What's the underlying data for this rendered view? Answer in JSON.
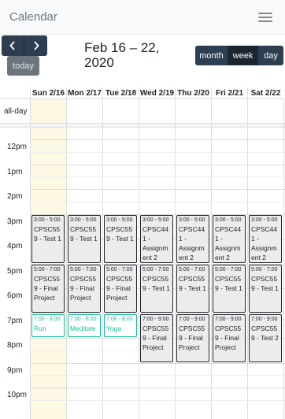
{
  "app": {
    "title": "Calendar"
  },
  "toolbar": {
    "prev_label": "‹",
    "next_label": "›",
    "today_label": "today",
    "range_title": "Feb 16 – 22, 2020",
    "views": {
      "month": "month",
      "week": "week",
      "day": "day"
    },
    "active_view": "week"
  },
  "calendar": {
    "days": [
      "Sun 2/16",
      "Mon 2/17",
      "Tue 2/18",
      "Wed 2/19",
      "Thu 2/20",
      "Fri 2/21",
      "Sat 2/22"
    ],
    "today_index": 0,
    "allday_label": "all-day",
    "hours": [
      "12pm",
      "1pm",
      "2pm",
      "3pm",
      "4pm",
      "5pm",
      "6pm",
      "7pm",
      "8pm",
      "9pm",
      "10pm"
    ],
    "events": [
      {
        "day": 0,
        "start": 15,
        "end": 17,
        "time": "3:00 - 5:00",
        "title": "CPSC559 - Test 1",
        "style": "gray"
      },
      {
        "day": 1,
        "start": 15,
        "end": 17,
        "time": "3:00 - 5:00",
        "title": "CPSC559 - Test 1",
        "style": "gray"
      },
      {
        "day": 2,
        "start": 15,
        "end": 17,
        "time": "3:00 - 5:00",
        "title": "CPSC559 - Test 1",
        "style": "gray"
      },
      {
        "day": 3,
        "start": 15,
        "end": 17,
        "time": "3:00 - 5:00",
        "title": "CPSC441 - Assignment 2",
        "style": "gray"
      },
      {
        "day": 4,
        "start": 15,
        "end": 17,
        "time": "3:00 - 5:00",
        "title": "CPSC441 - Assignment 2",
        "style": "gray"
      },
      {
        "day": 5,
        "start": 15,
        "end": 17,
        "time": "3:00 - 5:00",
        "title": "CPSC441 - Assignment 2",
        "style": "gray"
      },
      {
        "day": 6,
        "start": 15,
        "end": 17,
        "time": "3:00 - 5:00",
        "title": "CPSC441 - Assignment 2",
        "style": "gray"
      },
      {
        "day": 0,
        "start": 17,
        "end": 19,
        "time": "5:00 - 7:00",
        "title": "CPSC559 - Final Project",
        "style": "gray"
      },
      {
        "day": 1,
        "start": 17,
        "end": 19,
        "time": "5:00 - 7:00",
        "title": "CPSC559 - Final Project",
        "style": "gray"
      },
      {
        "day": 2,
        "start": 17,
        "end": 19,
        "time": "5:00 - 7:00",
        "title": "CPSC559 - Final Project",
        "style": "gray"
      },
      {
        "day": 3,
        "start": 17,
        "end": 19,
        "time": "5:00 - 7:00",
        "title": "CPSC559 - Test 1",
        "style": "gray"
      },
      {
        "day": 4,
        "start": 17,
        "end": 19,
        "time": "5:00 - 7:00",
        "title": "CPSC559 - Test 1",
        "style": "gray"
      },
      {
        "day": 5,
        "start": 17,
        "end": 19,
        "time": "5:00 - 7:00",
        "title": "CPSC559 - Test 1",
        "style": "gray"
      },
      {
        "day": 6,
        "start": 17,
        "end": 19,
        "time": "5:00 - 7:00",
        "title": "CPSC559 - Test 1",
        "style": "gray"
      },
      {
        "day": 0,
        "start": 19,
        "end": 20,
        "time": "7:00 - 8:00",
        "title": "Run",
        "style": "green"
      },
      {
        "day": 1,
        "start": 19,
        "end": 20,
        "time": "7:00 - 8:00",
        "title": "Meditate",
        "style": "green"
      },
      {
        "day": 2,
        "start": 19,
        "end": 20,
        "time": "7:00 - 8:00",
        "title": "Yoga",
        "style": "green"
      },
      {
        "day": 3,
        "start": 19,
        "end": 21,
        "time": "7:00 - 9:00",
        "title": "CPSC559 - Final Project",
        "style": "gray"
      },
      {
        "day": 4,
        "start": 19,
        "end": 21,
        "time": "7:00 - 9:00",
        "title": "CPSC559 - Final Project",
        "style": "gray"
      },
      {
        "day": 5,
        "start": 19,
        "end": 21,
        "time": "7:00 - 9:00",
        "title": "CPSC559 - Final Project",
        "style": "gray"
      },
      {
        "day": 6,
        "start": 19,
        "end": 21,
        "time": "7:00 - 9:00",
        "title": "CPSC559 - Test 2",
        "style": "gray"
      }
    ]
  }
}
